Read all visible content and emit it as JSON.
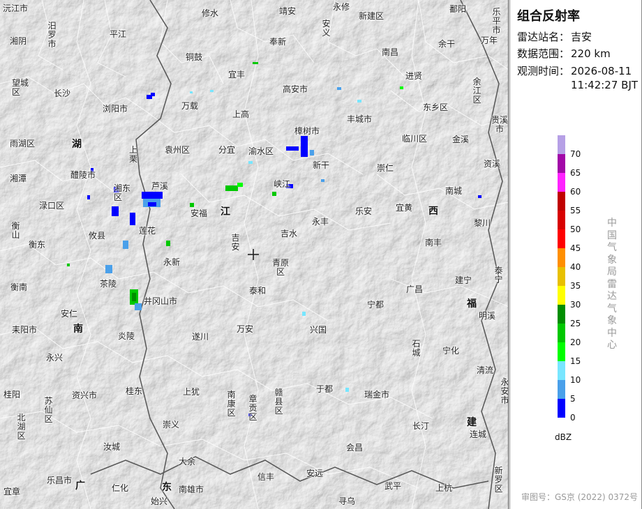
{
  "panel": {
    "title": "组合反射率",
    "station_label": "雷达站名：",
    "station_value": "吉安",
    "range_label": "数据范围：",
    "range_value": "220 km",
    "time_label": "观测时间：",
    "time_value_date": "2026-08-11",
    "time_value_clock": "11:42:27 BJT",
    "unit": "dBZ",
    "vertical_text": "中国气象局雷达气象中心",
    "footer": "审图号：GS京 (2022) 0372号"
  },
  "legend": {
    "colors": [
      "#b6a0e6",
      "#a208a8",
      "#ff22ff",
      "#c00000",
      "#d80000",
      "#ff0000",
      "#ff8f00",
      "#e8c000",
      "#ffff00",
      "#008e00",
      "#00c800",
      "#00ff00",
      "#78e6ff",
      "#4aa0ea",
      "#0000ff"
    ],
    "labels": [
      "70",
      "65",
      "60",
      "55",
      "50",
      "45",
      "40",
      "35",
      "30",
      "25",
      "20",
      "15",
      "10",
      "5",
      "0"
    ]
  },
  "provinces": [
    {
      "name": "湖"
    },
    {
      "name": "南"
    },
    {
      "name": "江"
    },
    {
      "name": "西"
    },
    {
      "name": "福"
    },
    {
      "name": "建"
    },
    {
      "name": "广"
    },
    {
      "name": "东"
    }
  ],
  "places": [
    "沅江市",
    "修水",
    "靖安",
    "永修",
    "新建区",
    "鄱阳",
    "乐平市",
    "汨罗市",
    "平江",
    "奉新",
    "安义",
    "湘阴",
    "铜鼓",
    "南昌",
    "余干",
    "万年",
    "望城区",
    "长沙",
    "宜丰",
    "高安市",
    "进贤",
    "余江区",
    "浏阳市",
    "万载",
    "东乡区",
    "贵溪市",
    "上高",
    "丰城市",
    "雨湖区",
    "樟树市",
    "临川区",
    "金溪",
    "上栗",
    "袁州区",
    "分宜",
    "渝水区",
    "湘潭",
    "醴陵市",
    "新干",
    "崇仁",
    "资溪",
    "湘东区",
    "芦溪",
    "峡江",
    "南城",
    "渌口区",
    "安福",
    "乐安",
    "宜黄",
    "衡山",
    "攸县",
    "莲花",
    "吉安",
    "吉水",
    "永丰",
    "黎川",
    "衡东",
    "南丰",
    "永新",
    "青原区",
    "泰宁",
    "茶陵",
    "建宁",
    "衡南",
    "泰和",
    "广昌",
    "井冈山市",
    "宁都",
    "明溪",
    "安仁",
    "耒阳市",
    "万安",
    "兴国",
    "炎陵",
    "遂川",
    "石城",
    "宁化",
    "永兴",
    "清流",
    "于都",
    "桂东",
    "上犹",
    "南康区",
    "章贡区",
    "赣县区",
    "瑞金市",
    "永安市",
    "桂阳",
    "资兴市",
    "苏仙区",
    "北湖区",
    "崇义",
    "长汀",
    "连城",
    "汝城",
    "会昌",
    "大余",
    "新罗区",
    "乐昌市",
    "仁化",
    "信丰",
    "安远",
    "上杭",
    "宜章",
    "南雄市",
    "武平",
    "始兴",
    "寻乌"
  ]
}
